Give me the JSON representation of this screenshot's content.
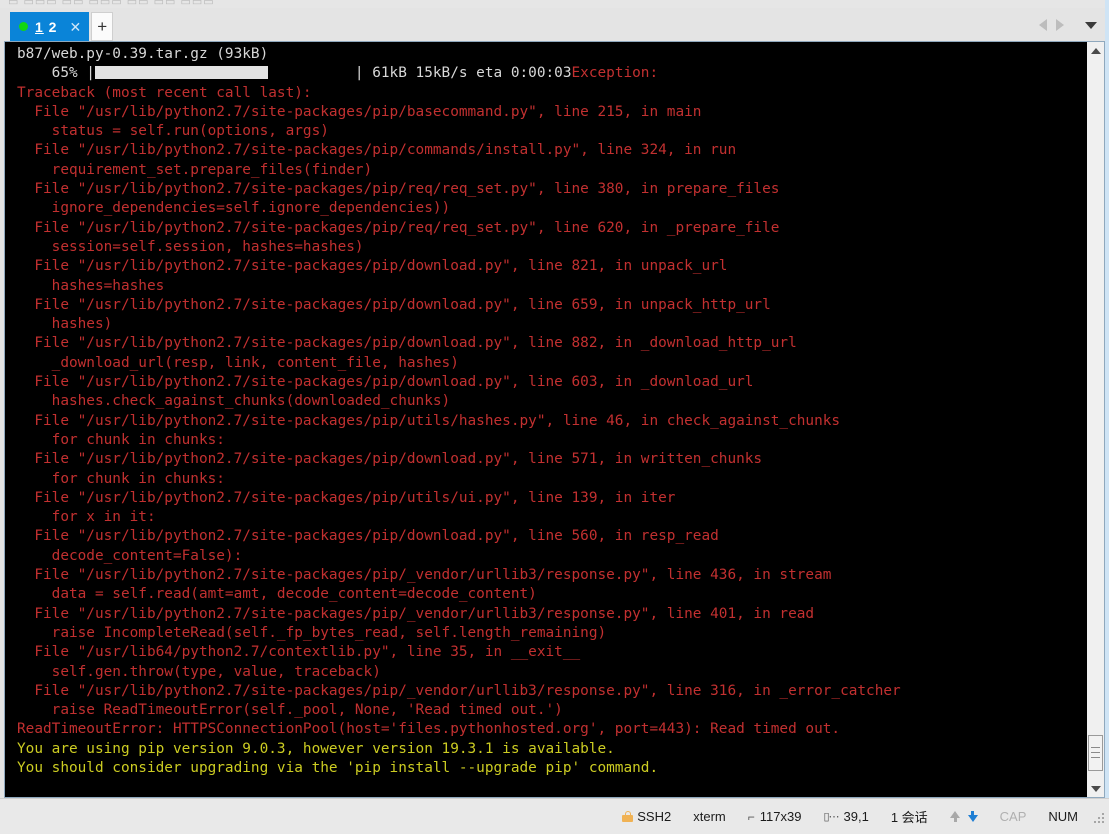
{
  "window": {
    "ghost_toolbar_text": "▭ ▭▭▭ ▭▭ ▭▭▭   ▭▭ ▭▭ ▭▭▭"
  },
  "tabbar": {
    "tab": {
      "title_underlined": "1",
      "title_rest": " 2",
      "close_label": "✕",
      "status_dot_color": "#12d712",
      "active_color": "#0a84d8"
    },
    "new_tab_label": "+",
    "nav": {
      "prev_icon": "triangle-left-icon",
      "next_icon": "triangle-right-icon",
      "menu_icon": "chevron-down-icon"
    }
  },
  "terminal": {
    "colors": {
      "background": "#000000",
      "white": "#d8d8d8",
      "red": "#c23030",
      "yellow": "#cccc22",
      "progress_fill": "#e3e3e3"
    },
    "download": {
      "file_line": "b87/web.py-0.39.tar.gz (93kB)",
      "percent": "65%",
      "percent_value": 65,
      "bar_prefix": "    65% |",
      "bar_suffix": "| 61kB 15kB/s eta 0:00:03",
      "transferred": "61kB",
      "rate": "15kB/s",
      "eta": "0:00:03",
      "exception_label": "Exception:"
    },
    "lines": [
      {
        "text": "Traceback (most recent call last):",
        "color": "red"
      },
      {
        "text": "  File \"/usr/lib/python2.7/site-packages/pip/basecommand.py\", line 215, in main",
        "color": "red"
      },
      {
        "text": "    status = self.run(options, args)",
        "color": "red"
      },
      {
        "text": "  File \"/usr/lib/python2.7/site-packages/pip/commands/install.py\", line 324, in run",
        "color": "red"
      },
      {
        "text": "    requirement_set.prepare_files(finder)",
        "color": "red"
      },
      {
        "text": "  File \"/usr/lib/python2.7/site-packages/pip/req/req_set.py\", line 380, in prepare_files",
        "color": "red"
      },
      {
        "text": "    ignore_dependencies=self.ignore_dependencies))",
        "color": "red"
      },
      {
        "text": "  File \"/usr/lib/python2.7/site-packages/pip/req/req_set.py\", line 620, in _prepare_file",
        "color": "red"
      },
      {
        "text": "    session=self.session, hashes=hashes)",
        "color": "red"
      },
      {
        "text": "  File \"/usr/lib/python2.7/site-packages/pip/download.py\", line 821, in unpack_url",
        "color": "red"
      },
      {
        "text": "    hashes=hashes",
        "color": "red"
      },
      {
        "text": "  File \"/usr/lib/python2.7/site-packages/pip/download.py\", line 659, in unpack_http_url",
        "color": "red"
      },
      {
        "text": "    hashes)",
        "color": "red"
      },
      {
        "text": "  File \"/usr/lib/python2.7/site-packages/pip/download.py\", line 882, in _download_http_url",
        "color": "red"
      },
      {
        "text": "    _download_url(resp, link, content_file, hashes)",
        "color": "red"
      },
      {
        "text": "  File \"/usr/lib/python2.7/site-packages/pip/download.py\", line 603, in _download_url",
        "color": "red"
      },
      {
        "text": "    hashes.check_against_chunks(downloaded_chunks)",
        "color": "red"
      },
      {
        "text": "  File \"/usr/lib/python2.7/site-packages/pip/utils/hashes.py\", line 46, in check_against_chunks",
        "color": "red"
      },
      {
        "text": "    for chunk in chunks:",
        "color": "red"
      },
      {
        "text": "  File \"/usr/lib/python2.7/site-packages/pip/download.py\", line 571, in written_chunks",
        "color": "red"
      },
      {
        "text": "    for chunk in chunks:",
        "color": "red"
      },
      {
        "text": "  File \"/usr/lib/python2.7/site-packages/pip/utils/ui.py\", line 139, in iter",
        "color": "red"
      },
      {
        "text": "    for x in it:",
        "color": "red"
      },
      {
        "text": "  File \"/usr/lib/python2.7/site-packages/pip/download.py\", line 560, in resp_read",
        "color": "red"
      },
      {
        "text": "    decode_content=False):",
        "color": "red"
      },
      {
        "text": "  File \"/usr/lib/python2.7/site-packages/pip/_vendor/urllib3/response.py\", line 436, in stream",
        "color": "red"
      },
      {
        "text": "    data = self.read(amt=amt, decode_content=decode_content)",
        "color": "red"
      },
      {
        "text": "  File \"/usr/lib/python2.7/site-packages/pip/_vendor/urllib3/response.py\", line 401, in read",
        "color": "red"
      },
      {
        "text": "    raise IncompleteRead(self._fp_bytes_read, self.length_remaining)",
        "color": "red"
      },
      {
        "text": "  File \"/usr/lib64/python2.7/contextlib.py\", line 35, in __exit__",
        "color": "red"
      },
      {
        "text": "    self.gen.throw(type, value, traceback)",
        "color": "red"
      },
      {
        "text": "  File \"/usr/lib/python2.7/site-packages/pip/_vendor/urllib3/response.py\", line 316, in _error_catcher",
        "color": "red"
      },
      {
        "text": "    raise ReadTimeoutError(self._pool, None, 'Read timed out.')",
        "color": "red"
      },
      {
        "text": "ReadTimeoutError: HTTPSConnectionPool(host='files.pythonhosted.org', port=443): Read timed out.",
        "color": "red"
      },
      {
        "text": "You are using pip version 9.0.3, however version 19.3.1 is available.",
        "color": "yellow"
      },
      {
        "text": "You should consider upgrading via the 'pip install --upgrade pip' command.",
        "color": "yellow"
      }
    ]
  },
  "scrollbar": {
    "up_icon": "scroll-up-arrow-icon",
    "down_icon": "scroll-down-arrow-icon"
  },
  "statusbar": {
    "protocol": "SSH2",
    "terminal_type": "xterm",
    "dimensions": "117x39",
    "cursor_position": "39,1",
    "sessions": "1 会话",
    "cap_label": "CAP",
    "num_label": "NUM",
    "lock_icon": "lock-icon",
    "size_icon": "terminal-size-icon",
    "cursor_icon": "cursor-position-icon",
    "upload_icon": "upload-arrow-icon",
    "download_icon": "download-arrow-icon"
  }
}
